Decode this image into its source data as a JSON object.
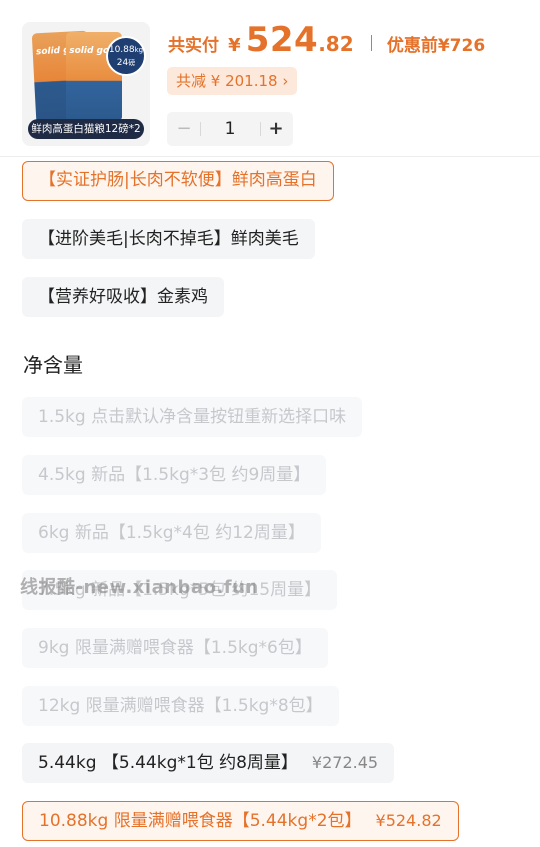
{
  "product": {
    "thumb_brand": "solid gold",
    "thumb_badge_weight": "10.88",
    "thumb_badge_unit": "kg",
    "thumb_badge_count": "24",
    "thumb_badge_count_unit": "磅",
    "thumb_caption": "鲜肉高蛋白猫粮12磅*2"
  },
  "price": {
    "pay_label": "共实付",
    "currency": "¥",
    "amount_int": "524",
    "amount_dec": ".82",
    "pre_label": "优惠前",
    "pre_amount": "¥726"
  },
  "discount": {
    "label": "共减 ¥ 201.18",
    "chevron": "›"
  },
  "quantity": {
    "minus": "−",
    "value": "1",
    "plus": "+"
  },
  "flavor_options": [
    {
      "label": "【实证护肠|长肉不软便】鲜肉高蛋白",
      "state": "selected"
    },
    {
      "label": "【进阶美毛|长肉不掉毛】鲜肉美毛",
      "state": "normal"
    },
    {
      "label": "【营养好吸收】金素鸡",
      "state": "normal"
    }
  ],
  "net_weight_title": "净含量",
  "weight_options": [
    {
      "label": "1.5kg 点击默认净含量按钮重新选择口味",
      "price": "",
      "state": "disabled"
    },
    {
      "label": "4.5kg 新品【1.5kg*3包 约9周量】",
      "price": "",
      "state": "disabled"
    },
    {
      "label": "6kg 新品【1.5kg*4包 约12周量】",
      "price": "",
      "state": "disabled"
    },
    {
      "label": "7.5kg 新品【1.5kg*5包 约15周量】",
      "price": "",
      "state": "disabled"
    },
    {
      "label": "9kg 限量满赠喂食器【1.5kg*6包】",
      "price": "",
      "state": "disabled"
    },
    {
      "label": "12kg 限量满赠喂食器【1.5kg*8包】",
      "price": "",
      "state": "disabled"
    },
    {
      "label": "5.44kg 【5.44kg*1包 约8周量】",
      "price": "¥272.45",
      "state": "normal"
    },
    {
      "label": "10.88kg 限量满赠喂食器【5.44kg*2包】",
      "price": "¥524.82",
      "state": "selected"
    }
  ],
  "watermark": "线报酷-new.xianbao.fun",
  "colors": {
    "accent": "#e5722a",
    "accent_bg": "#fde9dc",
    "option_bg": "#f4f5f7",
    "disabled_text": "#c6c8cc"
  }
}
